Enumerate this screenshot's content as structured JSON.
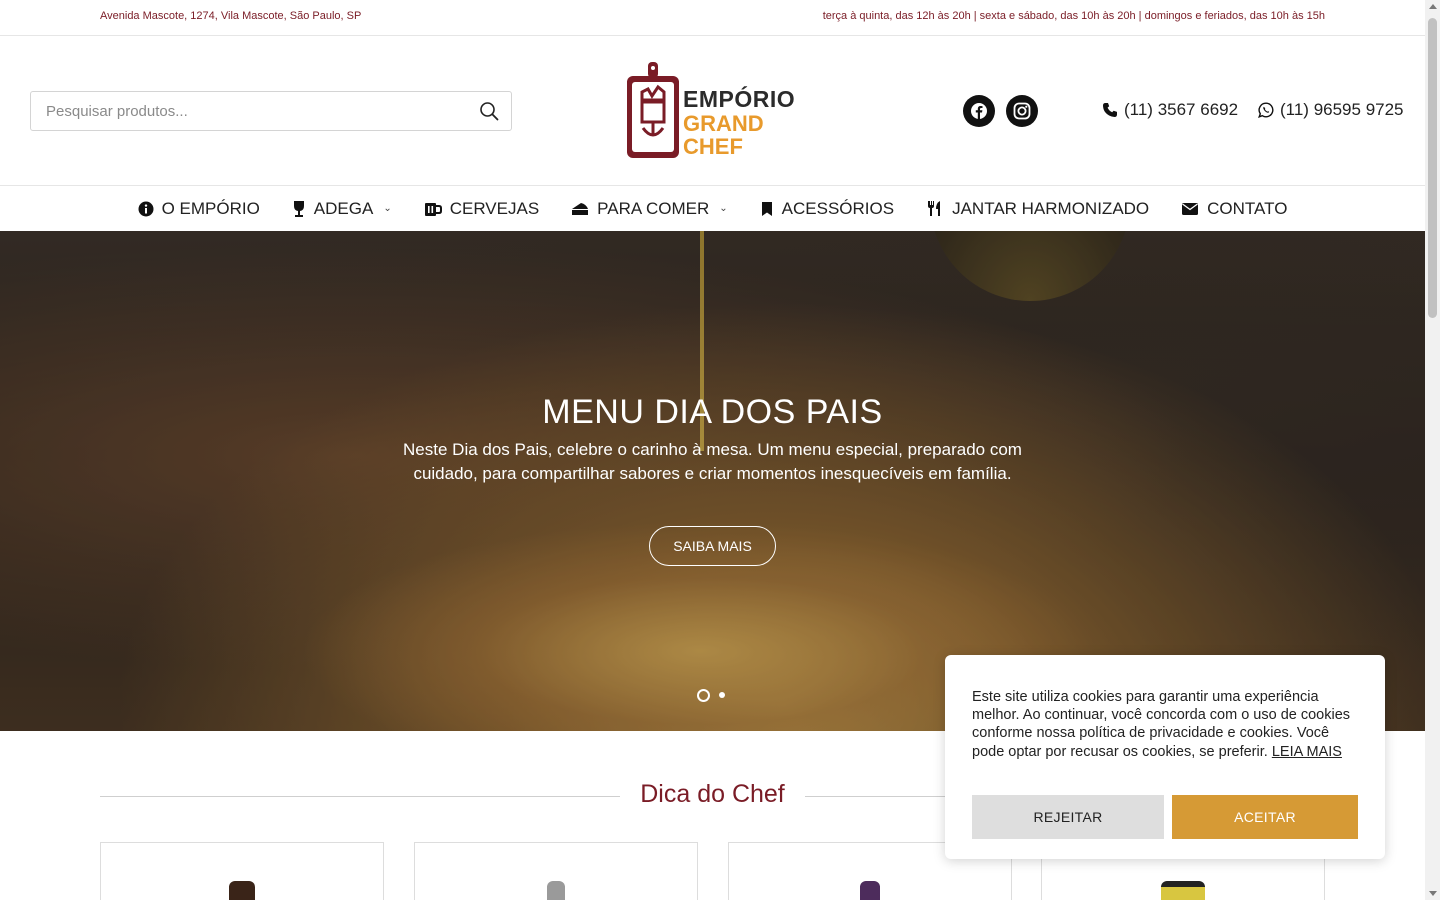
{
  "topbar": {
    "address": "Avenida Mascote, 1274, Vila Mascote, São Paulo, SP",
    "hours": "terça à quinta, das 12h às 20h | sexta e sábado, das 10h às 20h | domingos e feriados, das 10h às 15h"
  },
  "header": {
    "search_placeholder": "Pesquisar produtos...",
    "logo_line1": "EMPÓRIO",
    "logo_line2a": "GRAND",
    "logo_line2b": "CHEF",
    "phone1": "(11) 3567 6692",
    "phone2": "(11) 96595 9725"
  },
  "nav": {
    "items": [
      {
        "label": "O EMPÓRIO",
        "icon": "info-circle-icon"
      },
      {
        "label": "ADEGA",
        "icon": "wine-glass-icon"
      },
      {
        "label": "CERVEJAS",
        "icon": "beer-mug-icon"
      },
      {
        "label": "PARA COMER",
        "icon": "cheese-icon"
      },
      {
        "label": "ACESSÓRIOS",
        "icon": "bookmark-icon"
      },
      {
        "label": "JANTAR HARMONIZADO",
        "icon": "utensils-icon"
      },
      {
        "label": "CONTATO",
        "icon": "envelope-icon"
      }
    ]
  },
  "hero": {
    "title": "MENU DIA DOS PAIS",
    "text": "Neste Dia dos Pais, celebre o carinho à mesa. Um menu especial, preparado com cuidado, para compartilhar sabores e criar momentos inesquecíveis em família.",
    "button": "SAIBA MAIS",
    "active_slide": 1,
    "slide_count": 2
  },
  "section": {
    "title": "Dica do Chef"
  },
  "cookie": {
    "text": "Este site utiliza cookies para garantir uma experiência melhor. Ao continuar, você concorda com o uso de cookies conforme nossa política de privacidade e cookies. Você pode optar por recusar os cookies, se preferir.",
    "link": "LEIA MAIS",
    "reject": "REJEITAR",
    "accept": "ACEITAR"
  },
  "colors": {
    "brand_wine": "#7a1c26",
    "brand_orange": "#e89a2c",
    "accept_button": "#d69a35"
  }
}
